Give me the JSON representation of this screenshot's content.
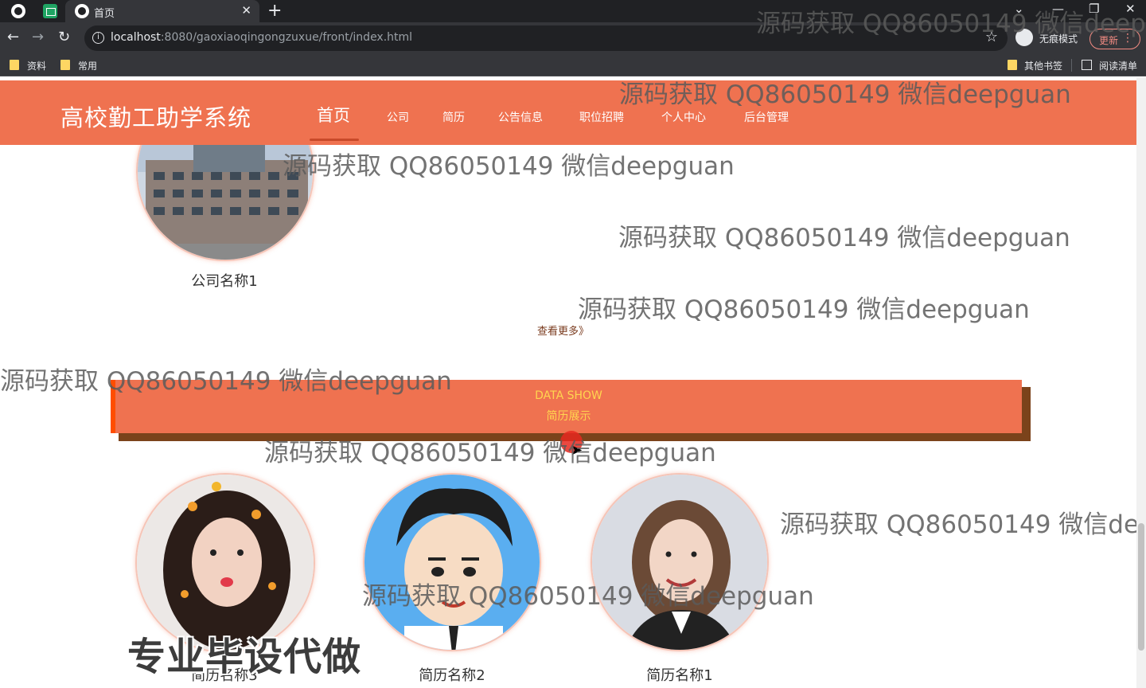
{
  "browser": {
    "tab_title": "首页",
    "url_host": "localhost",
    "url_rest": ":8080/gaoxiaoqingongzuxue/front/index.html",
    "incognito_label": "无痕模式",
    "update_label": "更新",
    "bookmarks": [
      "资料",
      "常用"
    ],
    "other_bookmarks": "其他书签",
    "reading_list": "阅读清单"
  },
  "site": {
    "title": "高校勤工助学系统",
    "nav": [
      "首页",
      "公司",
      "简历",
      "公告信息",
      "职位招聘",
      "个人中心",
      "后台管理"
    ],
    "active_nav": "首页"
  },
  "company_section": {
    "cards": [
      {
        "name": "公司名称1"
      }
    ],
    "more_label": "查看更多》"
  },
  "resume_banner": {
    "en": "DATA SHOW",
    "cn": "简历展示"
  },
  "resume_section": {
    "cards": [
      {
        "name": "简历名称3"
      },
      {
        "name": "简历名称2"
      },
      {
        "name": "简历名称1"
      }
    ]
  },
  "overlays": {
    "watermark": "源码获取 QQ86050149 微信deepguan",
    "promo": "专业毕设代做"
  },
  "colors": {
    "accent": "#ef7250",
    "banner_shadow": "#7b431b",
    "banner_text": "#ffd54f"
  }
}
